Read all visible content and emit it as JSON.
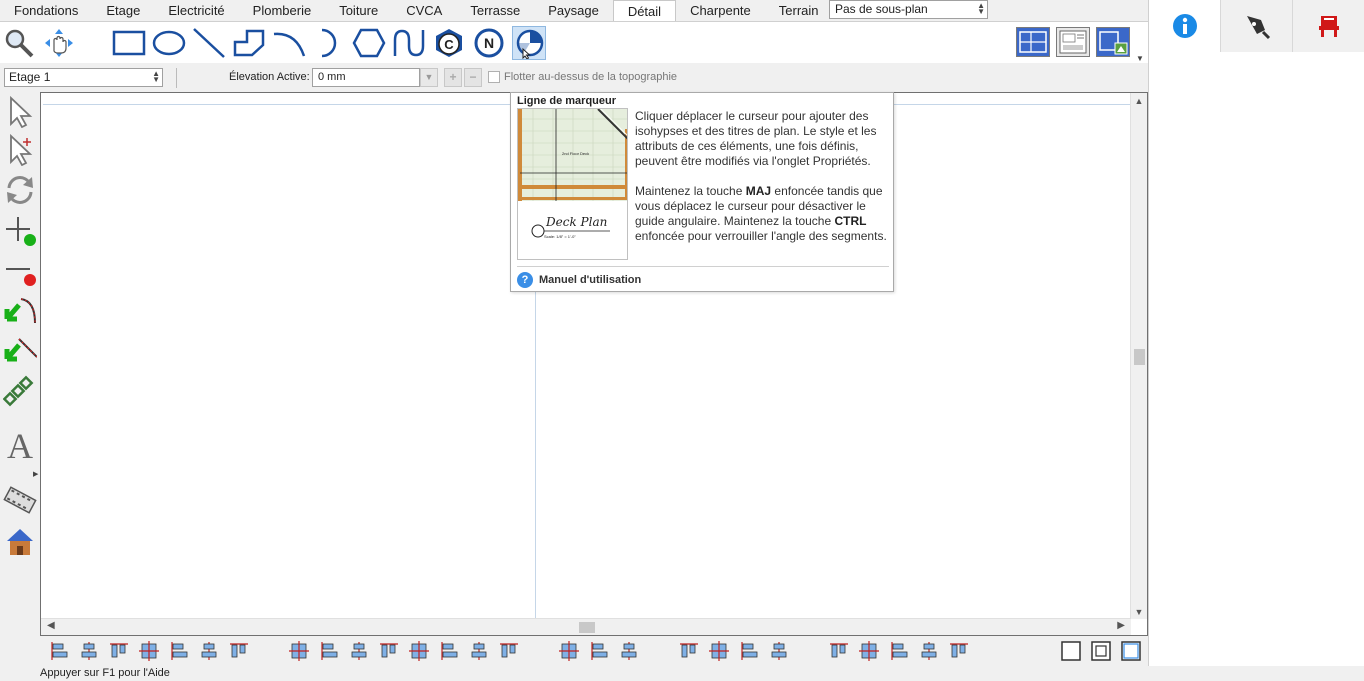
{
  "tabs": [
    {
      "label": "Fondations",
      "active": false
    },
    {
      "label": "Etage",
      "active": false
    },
    {
      "label": "Electricité",
      "active": false
    },
    {
      "label": "Plomberie",
      "active": false
    },
    {
      "label": "Toiture",
      "active": false
    },
    {
      "label": "CVCA",
      "active": false
    },
    {
      "label": "Terrasse",
      "active": false
    },
    {
      "label": "Paysage",
      "active": false
    },
    {
      "label": "Détail",
      "active": true
    },
    {
      "label": "Charpente",
      "active": false
    },
    {
      "label": "Terrain",
      "active": false
    }
  ],
  "subplan_select": {
    "value": "Pas de sous-plan"
  },
  "ribbon": {
    "tools": [
      "zoom-icon",
      "pan-icon",
      "rectangle-icon",
      "ellipse-icon",
      "line-icon",
      "polyline-icon",
      "arc-icon",
      "half-circle-icon",
      "hexagon-icon",
      "spline-icon",
      "copyright-symbol-icon",
      "north-arrow-icon",
      "marker-line-icon"
    ],
    "selected_tool": "marker-line-icon",
    "view_tools": [
      "plan-view-icon",
      "layout-view-icon",
      "site-plan-view-icon"
    ]
  },
  "options_bar": {
    "floor": "Etage 1",
    "elevation_label": "Élevation Active:",
    "elevation_value": "0 mm",
    "float_label": "Flotter au-dessus de la topographie",
    "float_checked": false
  },
  "left_tools": [
    "select-icon",
    "select-modify-icon",
    "rotate-icon",
    "add-point-icon",
    "remove-point-icon",
    "break-line-icon",
    "break-curve-icon",
    "chain-icon",
    "text-icon",
    "film-icon",
    "house-icon"
  ],
  "tooltip": {
    "title": "Ligne de marqueur",
    "image_caption_title": "Deck Plan",
    "image_caption_scale": "Scale: 1/8\" = 1'-0\"",
    "image_inner_label": "2nd Floor Deck",
    "para1": "Cliquer déplacer le curseur pour ajouter des isohypses et des titres de plan. Le style et les attributs de ces éléments, une fois définis, peuvent être modifiés via l'onglet Propriétés.",
    "para2_a": "Maintenez la touche ",
    "para2_key1": "MAJ",
    "para2_b": " enfoncée tandis que vous déplacez le curseur pour désactiver le guide angulaire. Maintenez la touche ",
    "para2_key2": "CTRL",
    "para2_c": " enfoncée pour verrouiller l'angle des segments.",
    "help_label": "Manuel d'utilisation"
  },
  "right_panel": {
    "tabs": [
      "info-icon",
      "pen-icon",
      "furniture-icon"
    ]
  },
  "status": {
    "text": "Appuyer sur F1 pour l'Aide"
  },
  "colors": {
    "accent": "#3a8ee6",
    "selected_bg": "#cfe3f7",
    "icon_blue": "#1a4fa0",
    "red": "#e02020",
    "green": "#18b018"
  }
}
